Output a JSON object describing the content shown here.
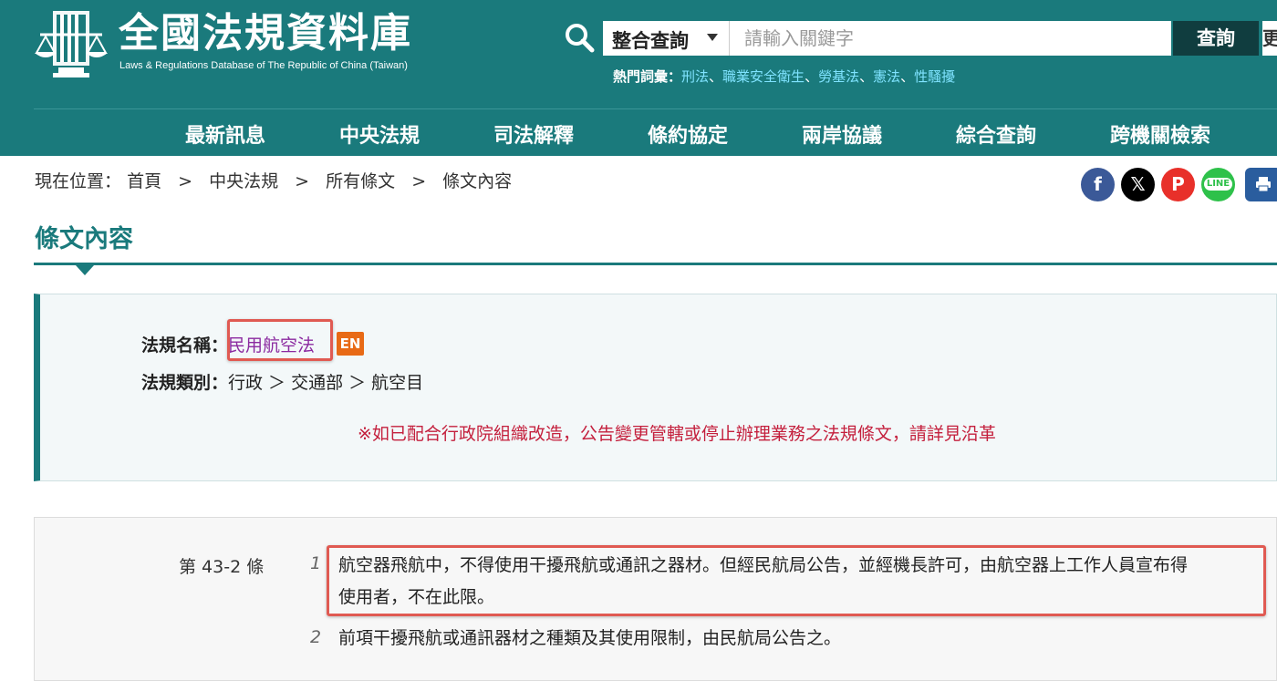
{
  "header": {
    "logo_title": "全國法規資料庫",
    "logo_subtitle": "Laws & Regulations Database of The Republic of China (Taiwan)",
    "search": {
      "scope_selected": "整合查詢",
      "placeholder": "請輸入關鍵字",
      "button_label": "查詢",
      "button2_label": "更"
    },
    "hot_terms": {
      "label": "熱門詞彙：",
      "items": [
        "刑法",
        "職業安全衛生",
        "勞基法",
        "憲法",
        "性騷擾"
      ],
      "separator": "、"
    },
    "nav": [
      "最新訊息",
      "中央法規",
      "司法解釋",
      "條約協定",
      "兩岸協議",
      "綜合查詢",
      "跨機關檢索"
    ]
  },
  "breadcrumb": {
    "label": "現在位置：",
    "items": [
      "首頁",
      "中央法規",
      "所有條文",
      "條文內容"
    ],
    "separator": ">"
  },
  "share": {
    "icons": [
      "facebook-icon",
      "x-icon",
      "plurk-icon",
      "line-icon",
      "print-icon"
    ],
    "colors": {
      "facebook": "#3b5998",
      "x": "#000000",
      "plurk": "#e8302a",
      "line": "#2ec14a",
      "print": "#2a5d9e"
    }
  },
  "page_title": "條文內容",
  "law_info": {
    "name_label": "法規名稱：",
    "name_value": "民用航空法",
    "en_badge": "EN",
    "category_label": "法規類別：",
    "category_value": "行政 ＞ 交通部 ＞ 航空目",
    "notice": "※如已配合行政院組織改造，公告變更管轄或停止辦理業務之法規條文，請詳見沿革"
  },
  "article": {
    "number": "第 43-2 條",
    "paragraphs": [
      {
        "num": "1",
        "line1": "航空器飛航中，不得使用干擾飛航或通訊之器材。但經民航局公告，並經機長許可，由航空器上工作人員宣布得",
        "line2": "使用者，不在此限。"
      },
      {
        "num": "2",
        "line1": "前項干擾飛航或通訊器材之種類及其使用限制，由民航局公告之。"
      }
    ]
  },
  "colors": {
    "brand": "#1a7a7c",
    "nav_dark": "#103d3f",
    "highlight_border": "#e05a52",
    "notice_red": "#c4203d",
    "link_purple": "#8b2aa0",
    "en_orange": "#e86a16"
  }
}
